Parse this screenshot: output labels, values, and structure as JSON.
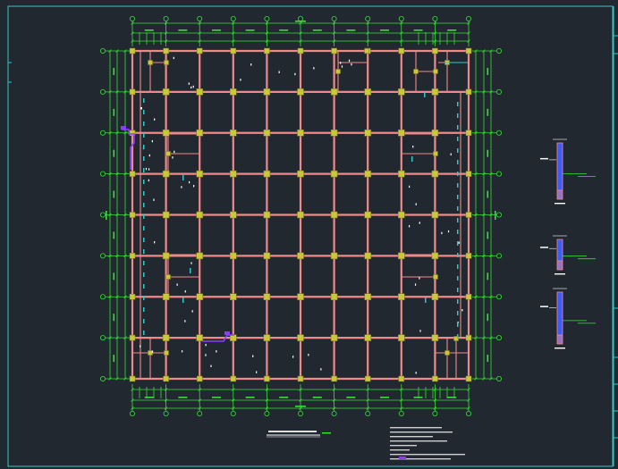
{
  "drawing": {
    "background": "#212830",
    "colors": {
      "frame": "#2fc9c9",
      "dim": "#37e037",
      "beam": "#f08a8a",
      "column": "#c8c83a",
      "accent": "#ffffff",
      "purple": "#8a3cff",
      "blue": "#3a5cff"
    },
    "grid": {
      "cols": 11,
      "rows": 9
    },
    "plan_title": "———",
    "detail_labels": [
      "",
      "",
      ""
    ]
  }
}
